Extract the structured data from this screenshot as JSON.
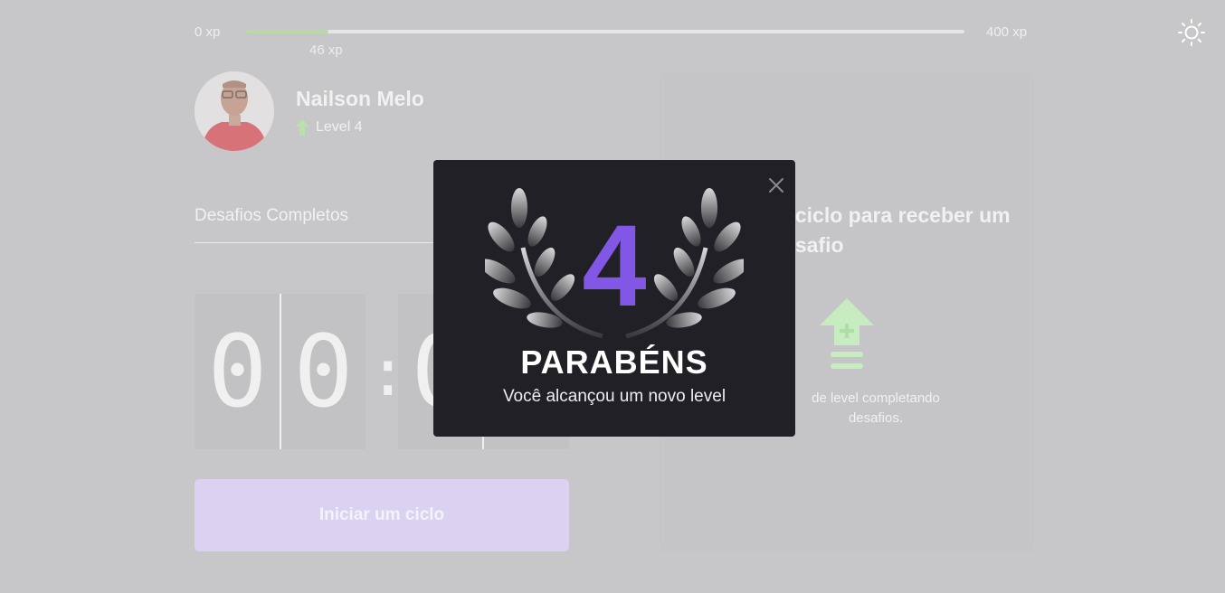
{
  "xp_bar": {
    "min_label": "0 xp",
    "max_label": "400 xp",
    "current_label": "46 xp",
    "progress_fraction": 0.115
  },
  "profile": {
    "name": "Nailson Melo",
    "level_label": "Level 4"
  },
  "challenges": {
    "label": "Desafios Completos"
  },
  "countdown": {
    "minutes_tens": "0",
    "minutes_ones": "0",
    "colon": ":",
    "seconds_tens": "0"
  },
  "start_button": {
    "label": "Iniciar um ciclo"
  },
  "challenge_card": {
    "title": "m ciclo para receber um desafio",
    "description": "de level completando desafios."
  },
  "modal": {
    "level": "4",
    "title": "PARABÉNS",
    "subtitle": "Você alcançou um novo level"
  },
  "icons": {
    "theme": "sun-icon",
    "level": "level-up-icon",
    "card": "level-up-icon",
    "close": "close-icon",
    "laurel": "laurel-icon"
  },
  "colors": {
    "accent": "#8257e5",
    "green": "#b8d9a4",
    "modal_bg": "#212026"
  }
}
